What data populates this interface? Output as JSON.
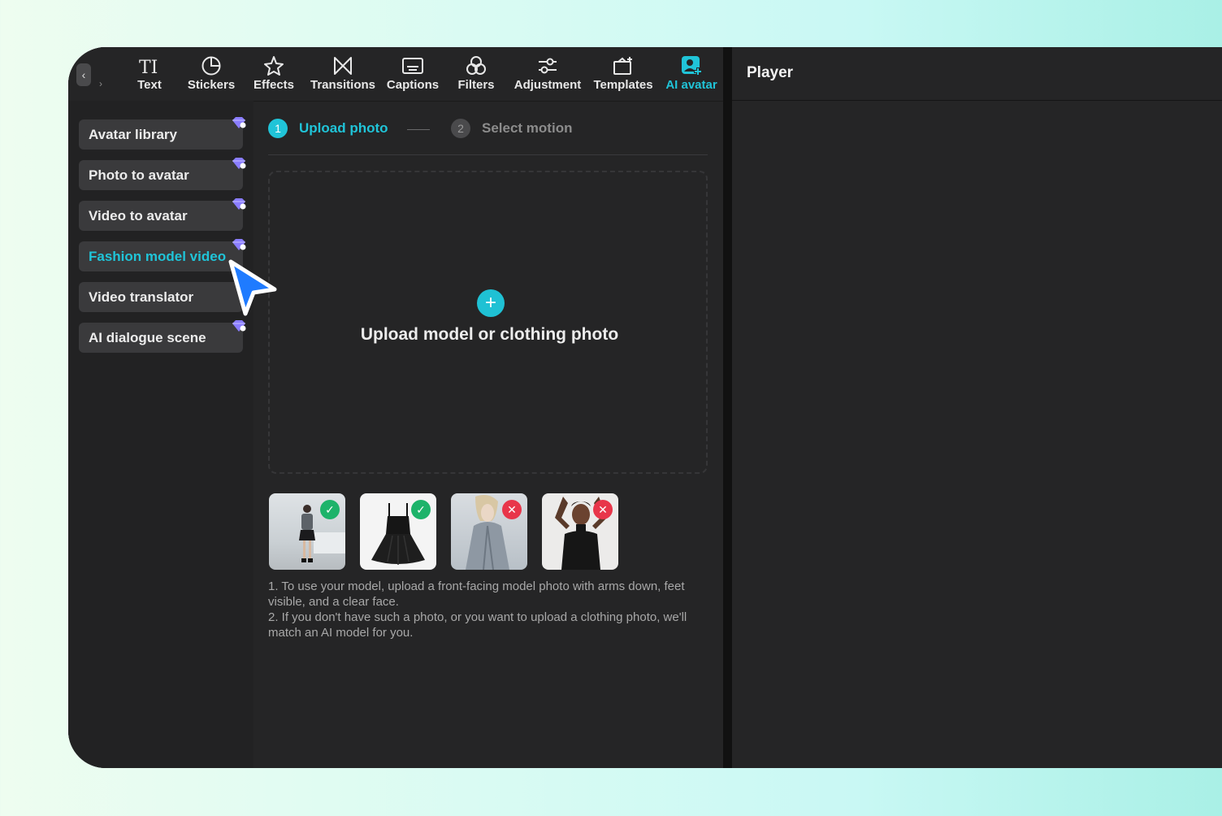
{
  "toolbar": {
    "tools": [
      {
        "label": "Text",
        "icon": "text-icon"
      },
      {
        "label": "Stickers",
        "icon": "sticker-icon"
      },
      {
        "label": "Effects",
        "icon": "effects-star-icon"
      },
      {
        "label": "Transitions",
        "icon": "transition-bowtie-icon"
      },
      {
        "label": "Captions",
        "icon": "captions-icon"
      },
      {
        "label": "Filters",
        "icon": "filters-icon"
      },
      {
        "label": "Adjustment",
        "icon": "sliders-icon"
      },
      {
        "label": "Templates",
        "icon": "templates-icon"
      },
      {
        "label": "AI avatar",
        "icon": "ai-avatar-icon",
        "active": true
      }
    ]
  },
  "sidebar": {
    "items": [
      {
        "label": "Avatar library",
        "premium": true
      },
      {
        "label": "Photo to avatar",
        "premium": true
      },
      {
        "label": "Video to avatar",
        "premium": true
      },
      {
        "label": "Fashion model video",
        "premium": true,
        "active": true
      },
      {
        "label": "Video translator",
        "premium": false
      },
      {
        "label": "AI dialogue scene",
        "premium": true
      }
    ]
  },
  "steps": [
    {
      "number": "1",
      "label": "Upload photo",
      "active": true
    },
    {
      "number": "2",
      "label": "Select motion",
      "active": false
    }
  ],
  "upload": {
    "label": "Upload model or clothing photo",
    "plus": "+"
  },
  "examples": [
    {
      "desc": "front-facing model",
      "valid": true
    },
    {
      "desc": "dress only",
      "valid": true
    },
    {
      "desc": "model in coat",
      "valid": false
    },
    {
      "desc": "model arms raised",
      "valid": false
    }
  ],
  "tips": [
    "1. To use your model, upload a front-facing model photo with arms down, feet visible, and a clear face.",
    "2. If you don't have such a photo, or you want to upload a clothing photo, we'll match an AI model for you."
  ],
  "player": {
    "title": "Player"
  },
  "colors": {
    "accent": "#20c4d8",
    "valid": "#1db36a",
    "invalid": "#e8364a",
    "premium": "#8a7dff"
  }
}
